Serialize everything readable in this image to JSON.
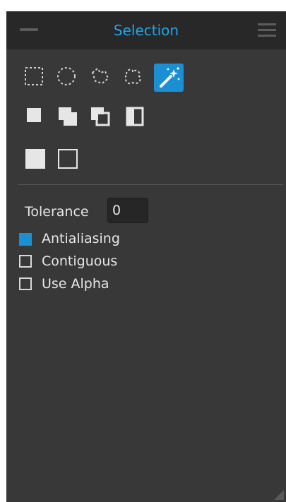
{
  "panel": {
    "title": "Selection",
    "accent_color": "#1ea6ea",
    "selected_color": "#1a8fd4",
    "collapse_icon": "minus-icon",
    "menu_icon": "hamburger-menu-icon"
  },
  "selection_tools": [
    {
      "name": "rectangle-select-icon",
      "selected": false
    },
    {
      "name": "ellipse-select-icon",
      "selected": false
    },
    {
      "name": "lasso-select-icon",
      "selected": false
    },
    {
      "name": "freehand-select-icon",
      "selected": false
    },
    {
      "name": "magic-wand-icon",
      "selected": true
    }
  ],
  "selection_modes": [
    {
      "name": "new-selection-icon"
    },
    {
      "name": "add-selection-icon"
    },
    {
      "name": "subtract-selection-icon"
    },
    {
      "name": "intersect-selection-icon"
    }
  ],
  "fill_modes": [
    {
      "name": "filled-square-icon"
    },
    {
      "name": "outline-square-icon"
    }
  ],
  "tolerance": {
    "label": "Tolerance",
    "value": "0"
  },
  "options": [
    {
      "label": "Antialiasing",
      "checked": true
    },
    {
      "label": "Contiguous",
      "checked": false
    },
    {
      "label": "Use Alpha",
      "checked": false
    }
  ]
}
